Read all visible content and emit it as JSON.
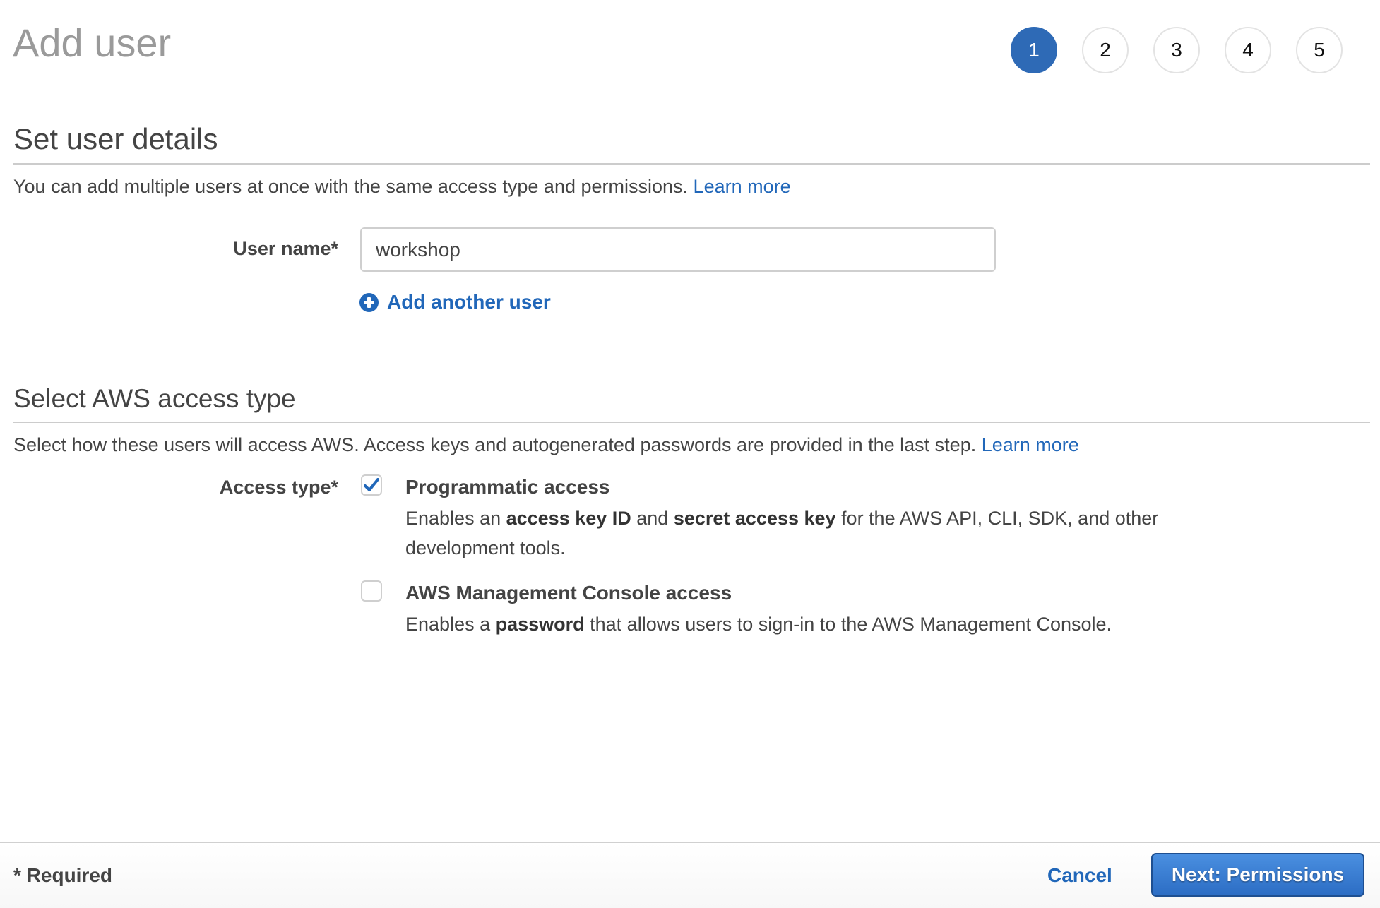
{
  "page": {
    "title": "Add user"
  },
  "steps": {
    "items": [
      "1",
      "2",
      "3",
      "4",
      "5"
    ],
    "active_index": 0,
    "active_color": "#2e6ab6"
  },
  "user_details": {
    "heading": "Set user details",
    "description": "You can add multiple users at once with the same access type and permissions.",
    "learn_more": "Learn more",
    "user_name_label": "User name*",
    "user_name_value": "workshop",
    "add_another_user": "Add another user",
    "add_icon": "plus-circle-icon"
  },
  "access_type": {
    "heading": "Select AWS access type",
    "description": "Select how these users will access AWS. Access keys and autogenerated passwords are provided in the last step.",
    "learn_more": "Learn more",
    "label": "Access type*",
    "options": [
      {
        "title": "Programmatic access",
        "checked": true,
        "desc_parts": [
          "Enables an ",
          "access key ID",
          " and ",
          "secret access key",
          " for the AWS API, CLI, SDK, and other development tools."
        ]
      },
      {
        "title": "AWS Management Console access",
        "checked": false,
        "desc_parts": [
          "Enables a ",
          "password",
          " that allows users to sign-in to the AWS Management Console."
        ]
      }
    ]
  },
  "footer": {
    "required_note": "* Required",
    "cancel_label": "Cancel",
    "next_label": "Next: Permissions",
    "link_color": "#2167b9"
  }
}
